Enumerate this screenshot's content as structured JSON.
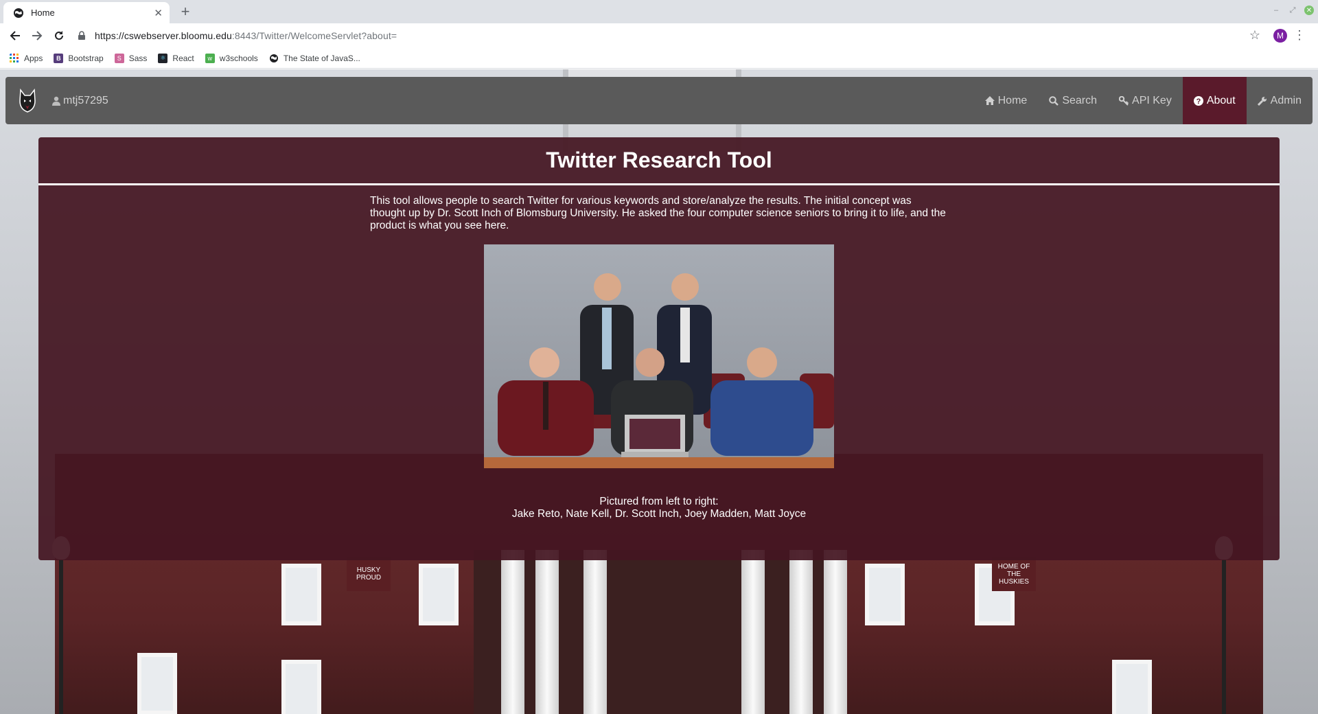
{
  "browser": {
    "tab": {
      "title": "Home"
    },
    "url": {
      "host": "https://cswebserver.bloomu.edu",
      "path": ":8443/Twitter/WelcomeServlet?about="
    },
    "profile_initial": "M",
    "bookmarks": [
      {
        "label": "Apps",
        "icon": "apps-grid-icon"
      },
      {
        "label": "Bootstrap",
        "icon": "bootstrap-icon"
      },
      {
        "label": "Sass",
        "icon": "sass-icon"
      },
      {
        "label": "React",
        "icon": "react-icon"
      },
      {
        "label": "w3schools",
        "icon": "w3schools-icon"
      },
      {
        "label": "The State of JavaS...",
        "icon": "globe-icon"
      }
    ]
  },
  "navbar": {
    "username": "mtj57295",
    "items": [
      {
        "label": "Home",
        "icon": "home-icon"
      },
      {
        "label": "Search",
        "icon": "search-icon"
      },
      {
        "label": "API Key",
        "icon": "key-icon"
      },
      {
        "label": "About",
        "icon": "question-icon",
        "active": true
      },
      {
        "label": "Admin",
        "icon": "wrench-icon"
      }
    ]
  },
  "panel": {
    "title": "Twitter Research Tool",
    "description": "This tool allows people to search Twitter for various keywords and store/analyze the results. The initial concept was thought up by Dr. Scott Inch of Blomsburg University. He asked the four computer science seniors to bring it to life, and the product is what you see here.",
    "caption_line1": "Pictured from left to right:",
    "caption_line2": "Jake Reto, Nate Kell, Dr. Scott Inch, Joey Madden, Matt Joyce"
  },
  "colors": {
    "navbar": "#5a5a5a",
    "active_nav": "#5a1a2b",
    "panel": "#441621"
  },
  "background_banners": [
    "HUSKY PROUD",
    "HOME OF THE HUSKIES"
  ]
}
